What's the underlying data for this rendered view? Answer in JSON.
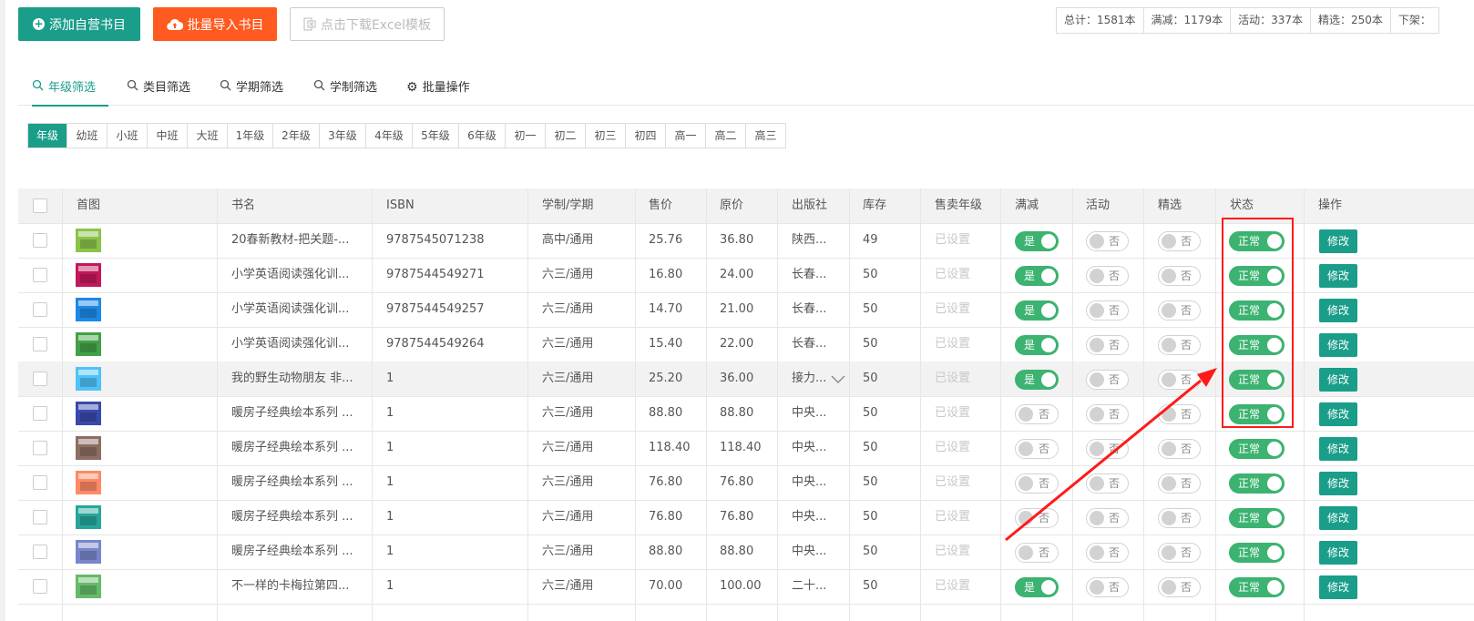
{
  "toolbar": {
    "add_label": "添加自营书目",
    "import_label": "批量导入书目",
    "download_label": "点击下载Excel模板"
  },
  "stats": [
    "总计：1581本",
    "满减：1179本",
    "活动：337本",
    "精选：250本",
    "下架："
  ],
  "filter_tabs": [
    {
      "label": "年级筛选",
      "icon": "search-icon",
      "active": true
    },
    {
      "label": "类目筛选",
      "icon": "search-icon"
    },
    {
      "label": "学期筛选",
      "icon": "search-icon"
    },
    {
      "label": "学制筛选",
      "icon": "search-icon"
    },
    {
      "label": "批量操作",
      "icon": "gear-icon"
    }
  ],
  "grades": [
    "年级",
    "幼班",
    "小班",
    "中班",
    "大班",
    "1年级",
    "2年级",
    "3年级",
    "4年级",
    "5年级",
    "6年级",
    "初一",
    "初二",
    "初三",
    "初四",
    "高一",
    "高二",
    "高三"
  ],
  "active_grade": 0,
  "table": {
    "headers": [
      "首图",
      "书名",
      "ISBN",
      "学制/学期",
      "售价",
      "原价",
      "出版社",
      "库存",
      "售卖年级",
      "满减",
      "活动",
      "精选",
      "状态",
      "操作"
    ],
    "rows": [
      {
        "cover": "#8bc34a",
        "title": "20春新教材-把关题-...",
        "isbn": "9787545071238",
        "term": "高中/通用",
        "price": "25.76",
        "orig": "36.80",
        "publisher": "陕西...",
        "stock": "49",
        "grade": "已设置",
        "manjian": true,
        "activity": false,
        "featured": false,
        "status": "正常",
        "edit": "修改"
      },
      {
        "cover": "#c2185b",
        "title": "小学英语阅读强化训...",
        "isbn": "9787544549271",
        "term": "六三/通用",
        "price": "16.80",
        "orig": "24.00",
        "publisher": "长春...",
        "stock": "50",
        "grade": "已设置",
        "manjian": true,
        "activity": false,
        "featured": false,
        "status": "正常",
        "edit": "修改"
      },
      {
        "cover": "#1e88e5",
        "title": "小学英语阅读强化训...",
        "isbn": "9787544549257",
        "term": "六三/通用",
        "price": "14.70",
        "orig": "21.00",
        "publisher": "长春...",
        "stock": "50",
        "grade": "已设置",
        "manjian": true,
        "activity": false,
        "featured": false,
        "status": "正常",
        "edit": "修改"
      },
      {
        "cover": "#43a047",
        "title": "小学英语阅读强化训...",
        "isbn": "9787544549264",
        "term": "六三/通用",
        "price": "15.40",
        "orig": "22.00",
        "publisher": "长春...",
        "stock": "50",
        "grade": "已设置",
        "manjian": true,
        "activity": false,
        "featured": false,
        "status": "正常",
        "edit": "修改"
      },
      {
        "cover": "#4fc3f7",
        "title": "我的野生动物朋友 非...",
        "isbn": "1",
        "term": "六三/通用",
        "price": "25.20",
        "orig": "36.00",
        "publisher": "接力...",
        "stock": "50",
        "grade": "已设置",
        "manjian": true,
        "activity": false,
        "featured": false,
        "status": "正常",
        "edit": "修改"
      },
      {
        "cover": "#3949ab",
        "title": "暖房子经典绘本系列 ...",
        "isbn": "1",
        "term": "六三/通用",
        "price": "88.80",
        "orig": "88.80",
        "publisher": "中央...",
        "stock": "50",
        "grade": "已设置",
        "manjian": false,
        "activity": false,
        "featured": false,
        "status": "正常",
        "edit": "修改"
      },
      {
        "cover": "#8d6e63",
        "title": "暖房子经典绘本系列 ...",
        "isbn": "1",
        "term": "六三/通用",
        "price": "118.40",
        "orig": "118.40",
        "publisher": "中央...",
        "stock": "50",
        "grade": "已设置",
        "manjian": false,
        "activity": false,
        "featured": false,
        "status": "正常",
        "edit": "修改"
      },
      {
        "cover": "#ff8a65",
        "title": "暖房子经典绘本系列 ...",
        "isbn": "1",
        "term": "六三/通用",
        "price": "76.80",
        "orig": "76.80",
        "publisher": "中央...",
        "stock": "50",
        "grade": "已设置",
        "manjian": false,
        "activity": false,
        "featured": false,
        "status": "正常",
        "edit": "修改"
      },
      {
        "cover": "#26a69a",
        "title": "暖房子经典绘本系列 ...",
        "isbn": "1",
        "term": "六三/通用",
        "price": "76.80",
        "orig": "76.80",
        "publisher": "中央...",
        "stock": "50",
        "grade": "已设置",
        "manjian": false,
        "activity": false,
        "featured": false,
        "status": "正常",
        "edit": "修改"
      },
      {
        "cover": "#7986cb",
        "title": "暖房子经典绘本系列 ...",
        "isbn": "1",
        "term": "六三/通用",
        "price": "88.80",
        "orig": "88.80",
        "publisher": "中央...",
        "stock": "50",
        "grade": "已设置",
        "manjian": false,
        "activity": false,
        "featured": false,
        "status": "正常",
        "edit": "修改"
      },
      {
        "cover": "#66bb6a",
        "title": "不一样的卡梅拉第四...",
        "isbn": "1",
        "term": "六三/通用",
        "price": "70.00",
        "orig": "100.00",
        "publisher": "二十...",
        "stock": "50",
        "grade": "已设置",
        "manjian": true,
        "activity": false,
        "featured": false,
        "status": "正常",
        "edit": "修改"
      }
    ],
    "toggle_on": "是",
    "toggle_off": "否"
  },
  "colors": {
    "primary": "#1a9e8a",
    "import": "#ff5a1f",
    "switch_on": "#3cb371",
    "annotation": "#ff1a1a"
  }
}
